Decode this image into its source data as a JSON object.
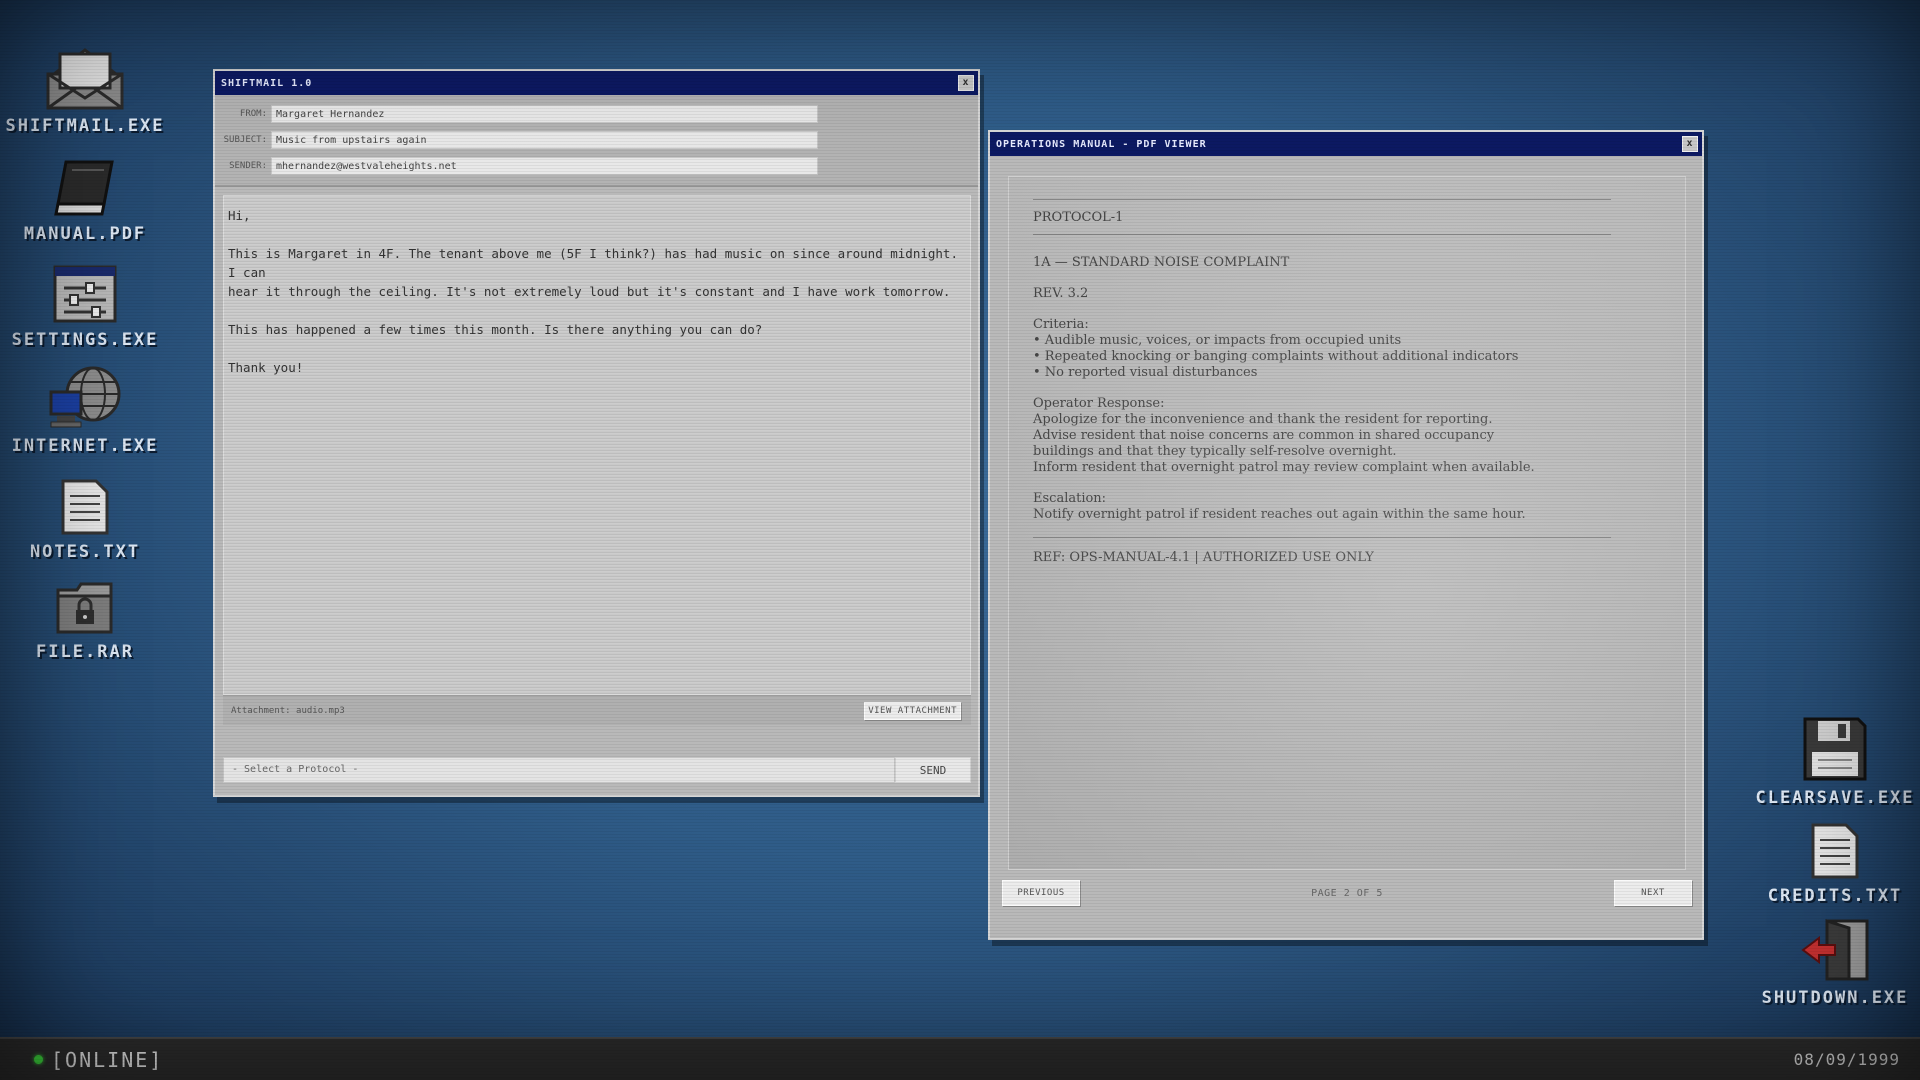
{
  "desktop": {
    "left_icons": [
      {
        "label": "SHIFTMAIL.EXE",
        "icon": "mail-envelope-icon"
      },
      {
        "label": "MANUAL.PDF",
        "icon": "book-icon"
      },
      {
        "label": "SETTINGS.EXE",
        "icon": "settings-sliders-icon"
      },
      {
        "label": "INTERNET.EXE",
        "icon": "globe-computer-icon"
      },
      {
        "label": "NOTES.TXT",
        "icon": "text-file-icon"
      },
      {
        "label": "FILE.RAR",
        "icon": "locked-folder-icon"
      }
    ],
    "right_icons": [
      {
        "label": "CLEARSAVE.EXE",
        "icon": "floppy-disk-icon"
      },
      {
        "label": "CREDITS.TXT",
        "icon": "text-file-icon"
      },
      {
        "label": "SHUTDOWN.EXE",
        "icon": "exit-door-icon"
      }
    ]
  },
  "mail_window": {
    "title": "SHIFTMAIL 1.0",
    "close_label": "x",
    "from_label": "FROM:",
    "from_value": "Margaret Hernandez",
    "subject_label": "SUBJECT:",
    "subject_value": "Music from upstairs again",
    "sender_label": "SENDER:",
    "sender_value": "mhernandez@westvaleheights.net",
    "body": [
      "Hi,",
      "This is Margaret in 4F. The tenant above me (5F I think?) has had music on since around midnight. I can\nhear it through the ceiling. It's not extremely loud but it's constant and I have work tomorrow.",
      "This has happened a few times this month. Is there anything you can do?",
      "Thank you!"
    ],
    "attachment_text": "Attachment: audio.mp3",
    "view_attachment_label": "VIEW ATTACHMENT",
    "protocol_placeholder": "- Select a Protocol -",
    "send_label": "SEND"
  },
  "pdf_window": {
    "title": "OPERATIONS MANUAL - PDF VIEWER",
    "close_label": "x",
    "protocol_heading": "PROTOCOL-1",
    "section_title": "1A — STANDARD NOISE COMPLAINT",
    "revision": "REV. 3.2",
    "criteria_label": "Criteria:",
    "criteria": [
      "• Audible music, voices, or impacts from occupied units",
      "• Repeated knocking or banging complaints without additional indicators",
      "• No reported visual disturbances"
    ],
    "response_label": "Operator Response:",
    "response_lines": [
      "Apologize for the inconvenience and thank the resident for reporting.",
      "Advise resident that noise concerns are common in shared occupancy",
      "buildings and that they typically self-resolve overnight.",
      "Inform resident that overnight patrol may review complaint when available."
    ],
    "escalation_label": "Escalation:",
    "escalation_lines": [
      "Notify overnight patrol if resident reaches out again within the same hour."
    ],
    "ref_line": "REF: OPS-MANUAL-4.1 | AUTHORIZED USE ONLY",
    "prev_label": "PREVIOUS",
    "next_label": "NEXT",
    "page_indicator": "PAGE 2 OF 5"
  },
  "taskbar": {
    "status": "[ONLINE]",
    "date": "08/09/1999",
    "status_color": "#3bd23b"
  }
}
